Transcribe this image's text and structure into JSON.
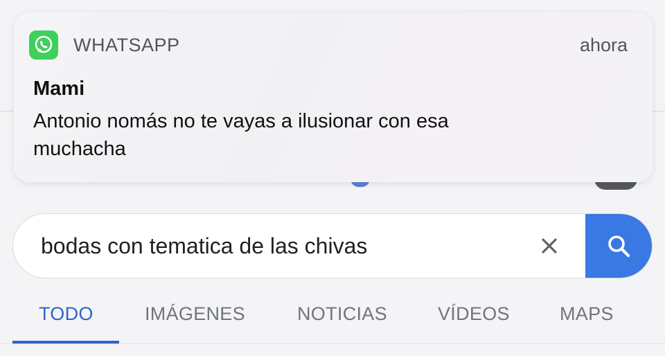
{
  "notification": {
    "app_name": "WHATSAPP",
    "time": "ahora",
    "sender": "Mami",
    "message": "Antonio nomás no te vayas a ilusionar con esa muchacha",
    "icon": "whatsapp-icon",
    "accent": "#3fd05c"
  },
  "search": {
    "query": "bodas con tematica de las chivas",
    "clear_icon": "close-icon",
    "search_icon": "search-icon",
    "button_color": "#3a78e3"
  },
  "tabs": [
    {
      "label": "TODO",
      "active": true
    },
    {
      "label": "IMÁGENES",
      "active": false
    },
    {
      "label": "NOTICIAS",
      "active": false
    },
    {
      "label": "VÍDEOS",
      "active": false
    },
    {
      "label": "MAPS",
      "active": false
    }
  ],
  "colors": {
    "active_tab": "#2a66c8",
    "inactive_tab": "#70757a"
  }
}
